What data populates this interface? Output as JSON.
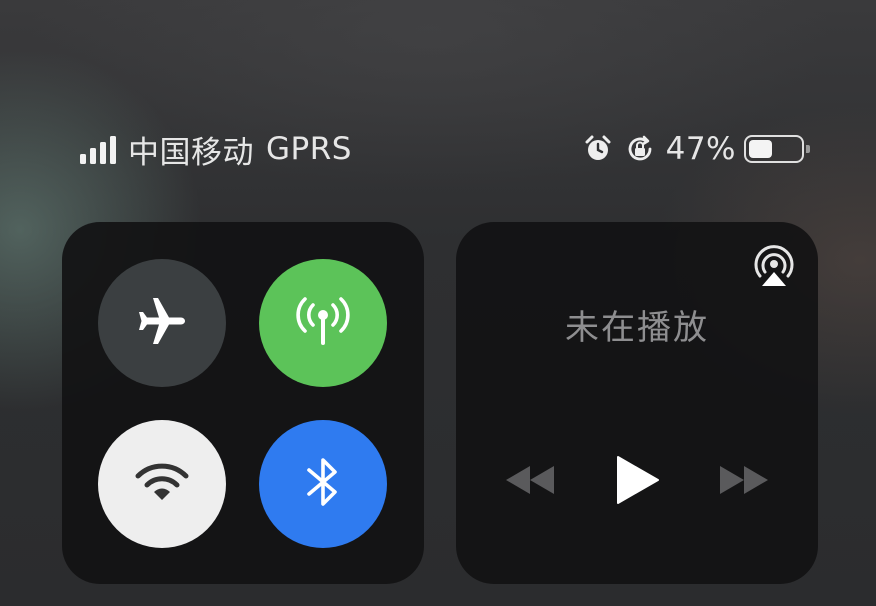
{
  "status_bar": {
    "carrier": "中国移动",
    "network": "GPRS",
    "signal_bars_total": 4,
    "signal_bars_active": 4,
    "alarm_icon": "alarm-clock-icon",
    "rotation_lock_icon": "rotation-lock-icon",
    "battery_percent_label": "47%",
    "battery_level": 0.47
  },
  "connectivity": {
    "airplane_mode": {
      "icon": "airplane-icon",
      "state": "off",
      "color": "#3b3f41"
    },
    "cellular_data": {
      "icon": "cellular-antenna-icon",
      "state": "on",
      "color": "#5cc359"
    },
    "wifi": {
      "icon": "wifi-icon",
      "state": "on",
      "color": "#eeeeee"
    },
    "bluetooth": {
      "icon": "bluetooth-icon",
      "state": "on",
      "color": "#2f7bf0"
    }
  },
  "media": {
    "status_label": "未在播放",
    "airplay_icon": "airplay-icon",
    "controls": [
      "rewind-icon",
      "play-icon",
      "fast-forward-icon"
    ]
  }
}
